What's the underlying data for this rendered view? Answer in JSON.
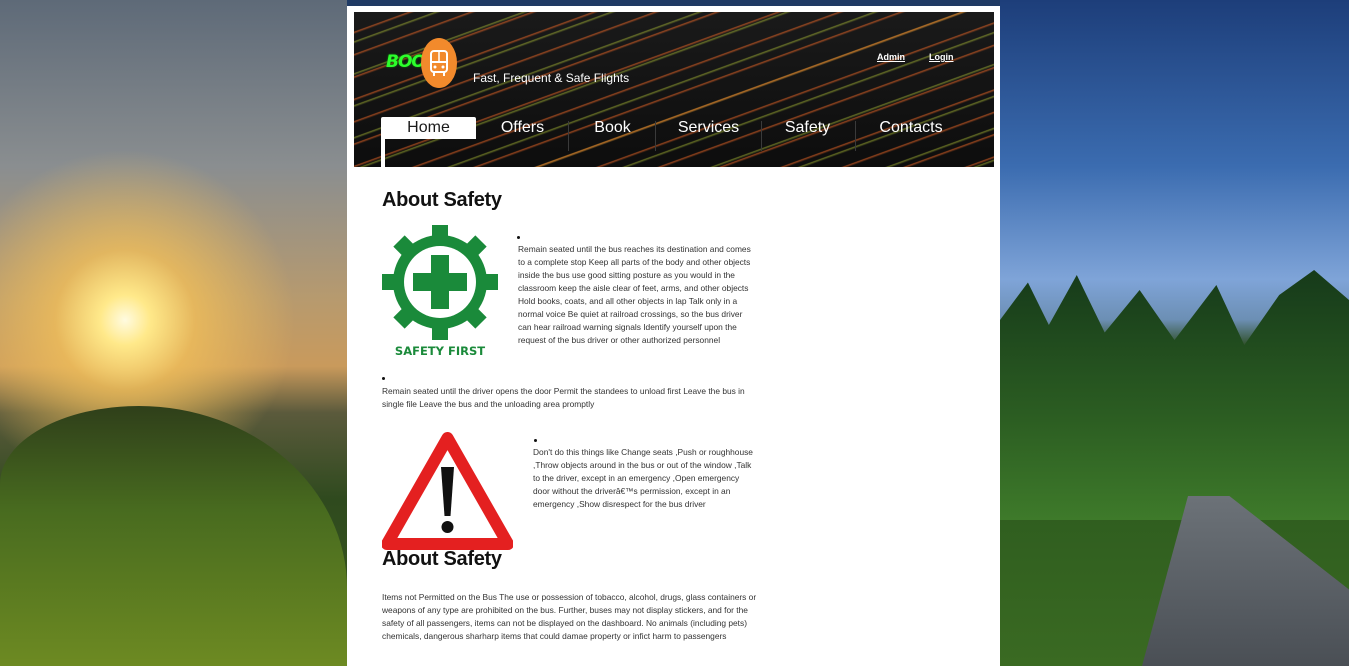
{
  "header": {
    "logo_text": "BOOK",
    "tagline": "Fast, Frequent & Safe Flights",
    "links": {
      "admin": "Admin",
      "login": "Login"
    }
  },
  "nav": {
    "items": [
      {
        "label": "Home",
        "active": true
      },
      {
        "label": "Offers"
      },
      {
        "label": "Book"
      },
      {
        "label": "Services"
      },
      {
        "label": "Safety"
      },
      {
        "label": "Contacts"
      }
    ]
  },
  "main": {
    "section1_title": "About Safety",
    "safety_first_caption": "SAFETY FIRST",
    "para1": "Remain seated until the bus reaches its destination and comes to a complete stop Keep all parts of the body and other objects inside the bus use good sitting posture as you would in the classroom keep the aisle clear of feet, arms, and other objects Hold books, coats, and all other objects in lap Talk only in a normal voice Be quiet at railroad crossings, so the bus driver can hear railroad warning signals Identify yourself upon the request of the bus driver or other authorized personnel",
    "para2": "Remain seated until the driver opens the door Permit the standees to unload first Leave the bus in single file Leave the bus and the unloading area promptly",
    "para3": "Don't do this things like Change seats ,Push or roughhouse ,Throw objects around in the bus or out of the window ,Talk to the driver, except in an emergency ,Open emergency door without the driverâ€™s permission, except in an emergency ,Show disrespect for the bus driver",
    "section2_title": "About Safety",
    "para4": "Items not Permitted on the Bus The use or possession of tobacco, alcohol, drugs, glass containers or weapons of any type are prohibited on the bus. Further, buses may not display stickers, and for the safety of all passengers, items can not be displayed on the dashboard. No animals (including pets) chemicals, dangerous sharharp items that could damae property or infict harm to passengers"
  },
  "colors": {
    "safety_green": "#1a8a3a",
    "warning_red": "#e42020",
    "logo_orange": "#f28a2c",
    "logo_green": "#2cff2c"
  }
}
